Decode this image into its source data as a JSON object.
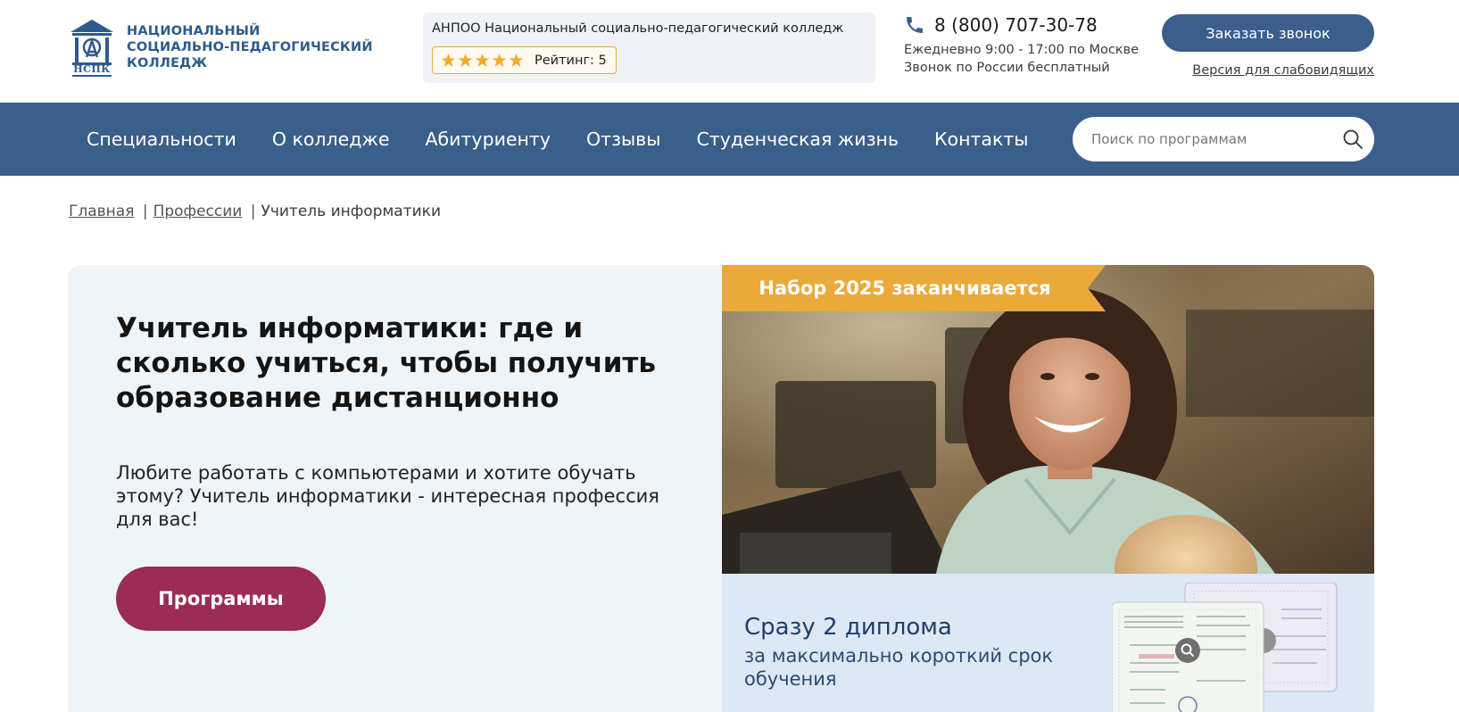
{
  "header": {
    "logo": {
      "text_lines": [
        "НАЦИОНАЛЬНЫЙ",
        "СОЦИАЛЬНО-ПЕДАГОГИЧЕСКИЙ",
        "КОЛЛЕДЖ"
      ],
      "mark_letters": "НСПК",
      "icon": "college-building-logo"
    },
    "rating": {
      "title": "АНПОО Национальный социально-педагогический колледж",
      "stars": 5,
      "label": "Рейтинг: 5",
      "star_color": "#f0ad2a"
    },
    "contact": {
      "phone": "8 (800) 707-30-78",
      "hours": "Ежедневно 9:00 - 17:00 по Москве",
      "note": "Звонок по России бесплатный",
      "icon": "phone-icon"
    },
    "callback_label": "Заказать звонок",
    "accessibility_label": "Версия для слабовидящих"
  },
  "nav": {
    "items": [
      "Специальности",
      "О колледже",
      "Абитуриенту",
      "Отзывы",
      "Студенческая жизнь",
      "Контакты"
    ],
    "search_placeholder": "Поиск по программам",
    "color": "#3b5f8b"
  },
  "breadcrumb": {
    "home": "Главная",
    "section": "Профессии",
    "current": "Учитель информатики",
    "separator": "|"
  },
  "hero": {
    "title": "Учитель информатики: где и сколько учиться, чтобы получить образование дистанционно",
    "description": "Любите работать с компьютерами и хотите обучать этому? Учитель информатики - интересная профессия для вас!",
    "button_label": "Программы",
    "ribbon": "Набор 2025 заканчивается",
    "diploma_title": "Сразу 2 диплома",
    "diploma_subtitle": "за максимально короткий срок обучения",
    "colors": {
      "button": "#9b2c55",
      "ribbon": "#eba93a",
      "panel": "#dce8f5"
    }
  }
}
